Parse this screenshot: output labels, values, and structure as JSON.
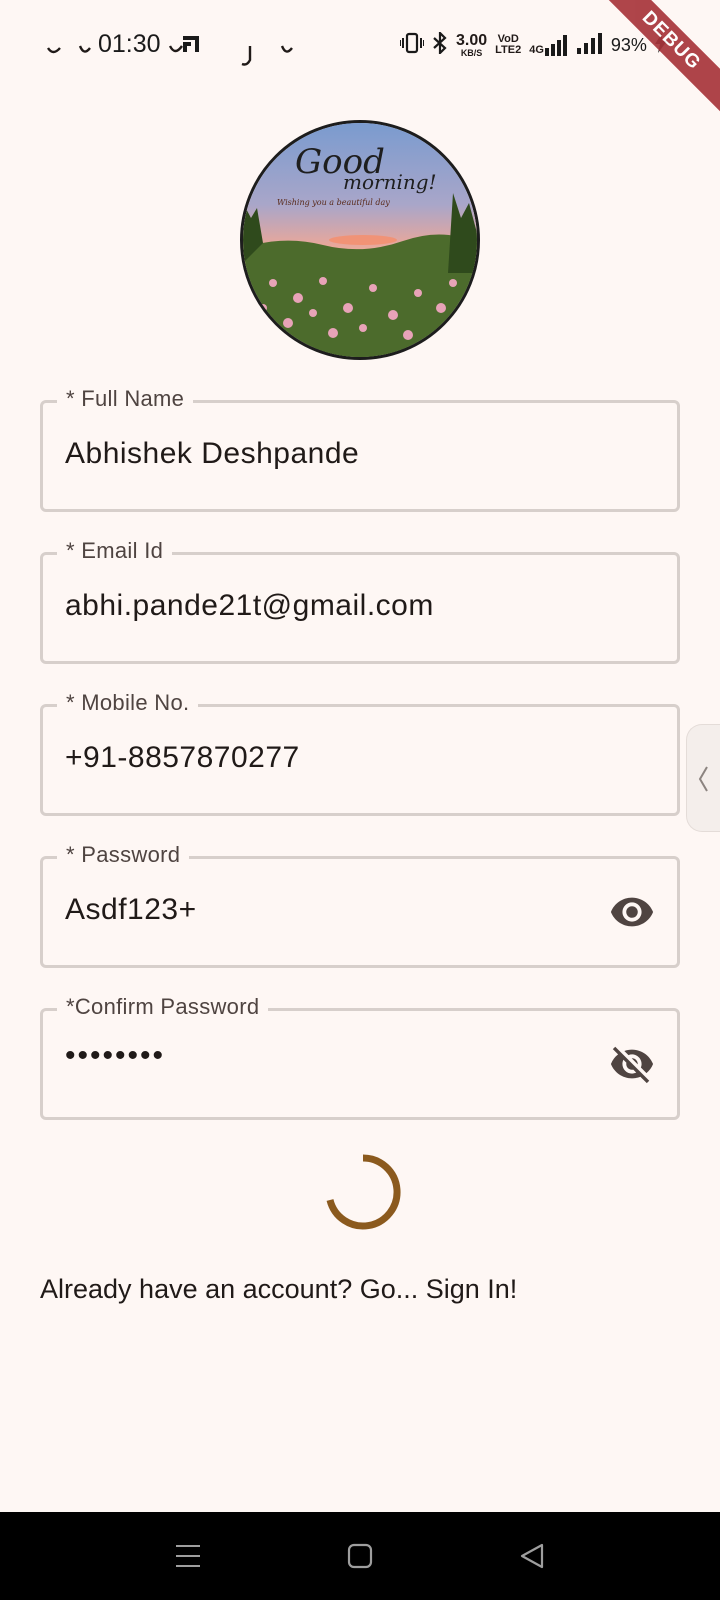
{
  "status_bar": {
    "time": "01:30",
    "net_speed_value": "3.00",
    "net_speed_unit": "KB/S",
    "volte": "VoLTE",
    "volte_line1": "VoD",
    "volte_line2": "LTE2",
    "network_type": "4G",
    "battery": "93%"
  },
  "debug_banner": "DEBUG",
  "avatar": {
    "text_line1": "Good",
    "text_line2": "morning!",
    "text_line3": "Wishing you a beautiful day"
  },
  "form": {
    "full_name": {
      "label": "* Full Name",
      "value": "Abhishek Deshpande"
    },
    "email": {
      "label": "* Email Id",
      "value": "abhi.pande21t@gmail.com"
    },
    "mobile": {
      "label": "* Mobile No.",
      "value": "+91-8857870277"
    },
    "password": {
      "label": "* Password",
      "value": "Asdf123+",
      "visibility_icon": "eye-icon"
    },
    "confirm_password": {
      "label": "*Confirm Password",
      "value": "••••••••",
      "visibility_icon": "eye-off-icon"
    }
  },
  "signin_link": "Already have an account? Go... Sign In!",
  "colors": {
    "background": "#fef7f4",
    "spinner": "#8b5a1e",
    "field_border": "#d7cfcb",
    "debug_banner": "#a8353b"
  }
}
